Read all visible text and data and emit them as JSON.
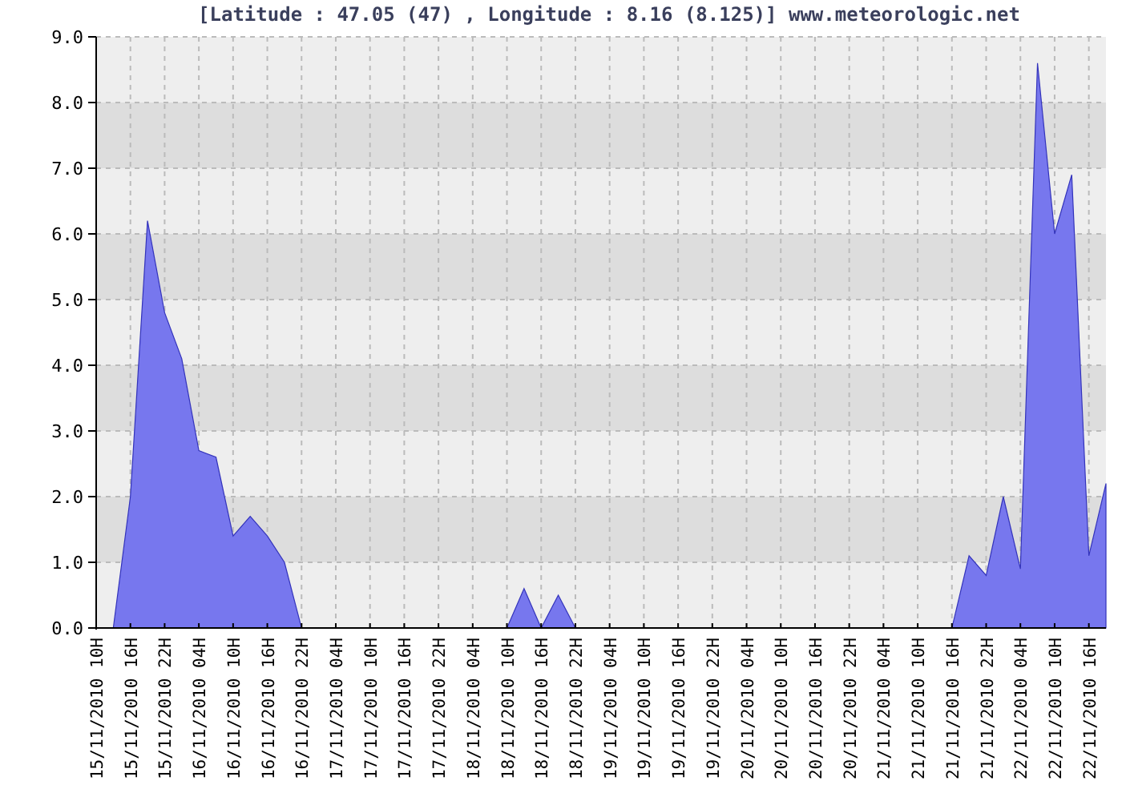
{
  "chart_data": {
    "type": "area",
    "title": "[Latitude : 47.05 (47) , Longitude : 8.16 (8.125)] www.meteorologic.net",
    "categories": [
      "15/11/2010 10H",
      null,
      "15/11/2010 16H",
      null,
      "15/11/2010 22H",
      null,
      "16/11/2010 04H",
      null,
      "16/11/2010 10H",
      null,
      "16/11/2010 16H",
      null,
      "16/11/2010 22H",
      null,
      "17/11/2010 04H",
      null,
      "17/11/2010 10H",
      null,
      "17/11/2010 16H",
      null,
      "17/11/2010 22H",
      null,
      "18/11/2010 04H",
      null,
      "18/11/2010 10H",
      null,
      "18/11/2010 16H",
      null,
      "18/11/2010 22H",
      null,
      "19/11/2010 04H",
      null,
      "19/11/2010 10H",
      null,
      "19/11/2010 16H",
      null,
      "19/11/2010 22H",
      null,
      "20/11/2010 04H",
      null,
      "20/11/2010 10H",
      null,
      "20/11/2010 16H",
      null,
      "20/11/2010 22H",
      null,
      "21/11/2010 04H",
      null,
      "21/11/2010 10H",
      null,
      "21/11/2010 16H",
      null,
      "21/11/2010 22H",
      null,
      "22/11/2010 04H",
      null,
      "22/11/2010 10H",
      null,
      "22/11/2010 16H",
      null
    ],
    "series": [
      {
        "color": "#7777ee",
        "values": [
          null,
          0,
          2.0,
          6.2,
          4.8,
          4.1,
          2.7,
          2.6,
          1.4,
          1.7,
          1.4,
          1.0,
          0,
          0,
          0,
          0,
          0,
          0,
          0,
          0,
          0,
          0,
          0,
          0,
          0,
          0.6,
          0,
          0.5,
          0,
          0,
          0,
          0,
          0,
          0,
          0,
          0,
          0,
          0,
          0,
          0,
          0,
          0,
          0,
          0,
          0,
          0,
          0,
          0,
          0,
          0,
          0,
          1.1,
          0.8,
          2.0,
          0.9,
          8.6,
          6.0,
          6.9,
          1.1,
          2.2
        ]
      }
    ],
    "ylim": [
      0,
      9
    ],
    "grid": true,
    "yticks": [
      {
        "value": 0,
        "label": "0.0"
      },
      {
        "value": 1,
        "label": "1.0"
      },
      {
        "value": 2,
        "label": "2.0"
      },
      {
        "value": 3,
        "label": "3.0"
      },
      {
        "value": 4,
        "label": "4.0"
      },
      {
        "value": 5,
        "label": "5.0"
      },
      {
        "value": 6,
        "label": "6.0"
      },
      {
        "value": 7,
        "label": "7.0"
      },
      {
        "value": 8,
        "label": "8.0"
      },
      {
        "value": 9,
        "label": "9.0"
      }
    ]
  }
}
